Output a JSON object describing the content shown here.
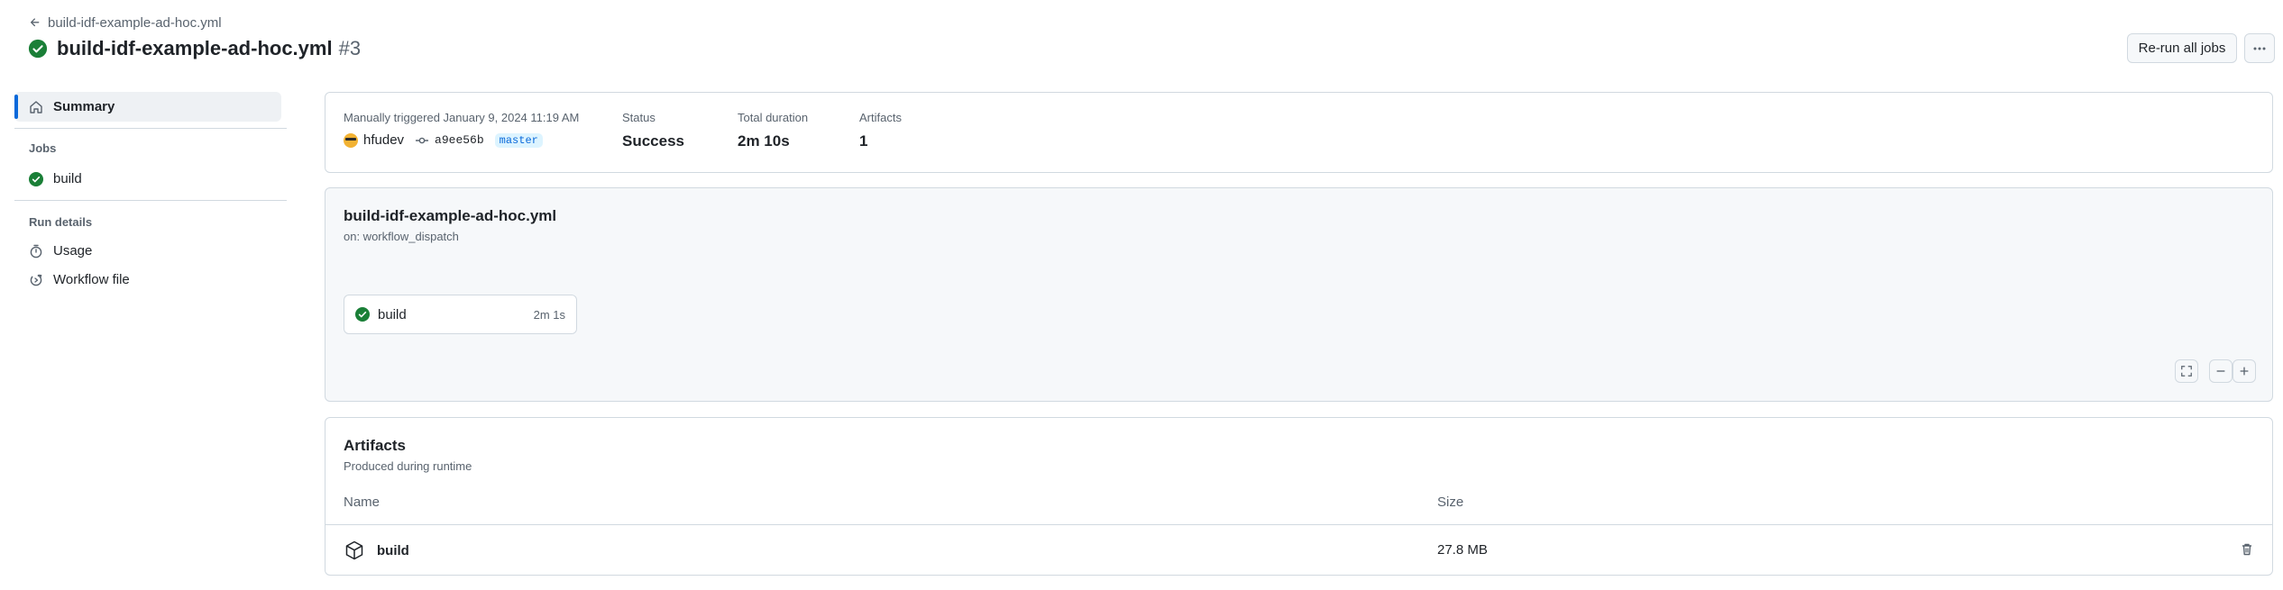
{
  "header": {
    "back_label": "build-idf-example-ad-hoc.yml",
    "title": "build-idf-example-ad-hoc.yml",
    "run_number": "#3",
    "rerun_label": "Re-run all jobs"
  },
  "sidebar": {
    "summary_label": "Summary",
    "jobs_heading": "Jobs",
    "jobs": [
      {
        "label": "build"
      }
    ],
    "run_details_heading": "Run details",
    "details": [
      {
        "label": "Usage"
      },
      {
        "label": "Workflow file"
      }
    ]
  },
  "summary": {
    "triggered_label": "Manually triggered January 9, 2024 11:19 AM",
    "actor": "hfudev",
    "commit_sha": "a9ee56b",
    "branch": "master",
    "status_label": "Status",
    "status_value": "Success",
    "duration_label": "Total duration",
    "duration_value": "2m 10s",
    "artifacts_label": "Artifacts",
    "artifacts_value": "1"
  },
  "graph": {
    "workflow_name": "build-idf-example-ad-hoc.yml",
    "trigger": "on: workflow_dispatch",
    "job": {
      "name": "build",
      "duration": "2m 1s"
    }
  },
  "artifacts": {
    "title": "Artifacts",
    "subtitle": "Produced during runtime",
    "columns": {
      "name": "Name",
      "size": "Size"
    },
    "rows": [
      {
        "name": "build",
        "size": "27.8 MB"
      }
    ]
  },
  "colors": {
    "success": "#1a7f37",
    "accent": "#0969da",
    "border": "#d1d9e0",
    "muted_text": "#59636e"
  },
  "icons": {
    "back": "arrow-left-icon",
    "status": "check-circle-fill-icon",
    "summary": "home-icon",
    "usage": "stopwatch-icon",
    "workflow_file": "workflow-icon",
    "commit": "git-commit-icon",
    "artifact": "package-icon",
    "delete": "trash-icon",
    "fullscreen": "screen-full-icon",
    "zoom_out": "dash-icon",
    "zoom_in": "plus-icon",
    "more": "kebab-horizontal-icon"
  }
}
